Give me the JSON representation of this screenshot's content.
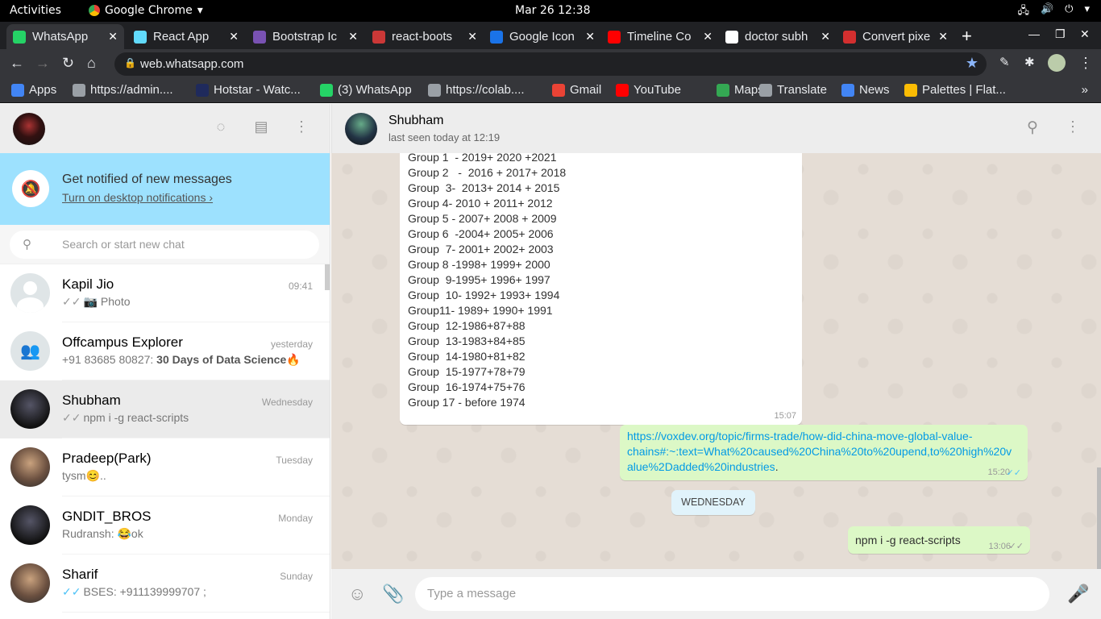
{
  "system": {
    "activities": "Activities",
    "app_name": "Google Chrome",
    "clock": "Mar 26  12:38"
  },
  "tabs": [
    {
      "title": "WhatsApp",
      "icon": "whatsapp-icon",
      "color": "#25d366",
      "active": true
    },
    {
      "title": "React App",
      "icon": "react-icon",
      "color": "#61dafb"
    },
    {
      "title": "Bootstrap Ic",
      "icon": "bootstrap-icon",
      "color": "#7952b3"
    },
    {
      "title": "react-boots",
      "icon": "npm-icon",
      "color": "#cb3837"
    },
    {
      "title": "Google Icon",
      "icon": "flag-icon",
      "color": "#1a73e8"
    },
    {
      "title": "Timeline Co",
      "icon": "youtube-icon",
      "color": "#ff0000"
    },
    {
      "title": "doctor subh",
      "icon": "google-icon",
      "color": "#ffffff"
    },
    {
      "title": "Convert pixe",
      "icon": "convert-icon",
      "color": "#d32f2f"
    }
  ],
  "address": {
    "url": "web.whatsapp.com"
  },
  "bookmarks": [
    {
      "label": "Apps",
      "icon": "apps-grid-icon",
      "color": "#4285f4"
    },
    {
      "label": "https://admin....",
      "icon": "globe-icon",
      "color": "#9aa0a6"
    },
    {
      "label": "Hotstar - Watc...",
      "icon": "hotstar-icon",
      "color": "#1f2a5c"
    },
    {
      "label": "(3) WhatsApp",
      "icon": "whatsapp-icon",
      "color": "#25d366"
    },
    {
      "label": "https://colab....",
      "icon": "globe-icon",
      "color": "#9aa0a6"
    },
    {
      "label": "Gmail",
      "icon": "gmail-icon",
      "color": "#ea4335"
    },
    {
      "label": "YouTube",
      "icon": "youtube-icon",
      "color": "#ff0000"
    },
    {
      "label": "Maps",
      "icon": "maps-icon",
      "color": "#34a853"
    },
    {
      "label": "Translate",
      "icon": "globe-icon",
      "color": "#9aa0a6"
    },
    {
      "label": "News",
      "icon": "news-icon",
      "color": "#4285f4"
    },
    {
      "label": "Palettes | Flat...",
      "icon": "palette-icon",
      "color": "#fbbc04"
    }
  ],
  "sidebar": {
    "notification": {
      "title": "Get notified of new messages",
      "link": "Turn on desktop notifications ›"
    },
    "search_placeholder": "Search or start new chat",
    "chats": [
      {
        "name": "Kapil Jio",
        "time": "09:41",
        "preview": "Photo",
        "ticks": "grey",
        "photo": true,
        "avatar": "default"
      },
      {
        "name": "Offcampus Explorer",
        "time": "yesterday",
        "sender": "+91 83685 80827: ",
        "preview": "30 Days of Data Science",
        "emoji": "🔥",
        "avatar": "group"
      },
      {
        "name": "Shubham",
        "time": "Wednesday",
        "preview": "npm i -g react-scripts",
        "ticks": "grey",
        "selected": true,
        "avatar": "dark"
      },
      {
        "name": "Pradeep(Park)",
        "time": "Tuesday",
        "preview": "tysm",
        "emoji": "😊",
        "suffix": "..",
        "avatar": "photo"
      },
      {
        "name": "GNDIT_BROS",
        "time": "Monday",
        "sender": "Rudransh: ",
        "emoji": "😂",
        "preview": "ok",
        "emoji_first": true,
        "avatar": "dark"
      },
      {
        "name": "Sharif",
        "time": "Sunday",
        "preview": "BSES: +911139999707 ;",
        "ticks": "blue",
        "avatar": "photo"
      }
    ]
  },
  "conversation": {
    "contact_name": "Shubham",
    "status": "last seen today at 12:19",
    "incoming": {
      "lines": [
        "Group 1  - 2019+ 2020 +2021",
        "Group 2   -  2016 + 2017+ 2018",
        "Group  3-  2013+ 2014 + 2015",
        "Group 4- 2010 + 2011+ 2012",
        "Group 5 - 2007+ 2008 + 2009",
        "Group 6  -2004+ 2005+ 2006",
        "Group  7- 2001+ 2002+ 2003",
        "Group 8 -1998+ 1999+ 2000",
        "Group  9-1995+ 1996+ 1997",
        "Group  10- 1992+ 1993+ 1994",
        "Group11- 1989+ 1990+ 1991",
        "Group  12-1986+87+88",
        "Group  13-1983+84+85",
        "Group  14-1980+81+82",
        "Group  15-1977+78+79",
        "Group  16-1974+75+76",
        "Group 17 - before 1974"
      ],
      "time": "15:07"
    },
    "link_message": {
      "text_l1": "https://voxdev.org/topic/firms-trade/how-did-china-move-global-value-",
      "text_l2": "chains#:~:text=What%20caused%20China%20to%20upend,to%20high%20v",
      "text_l3": "alue%2Dadded%20industries",
      "suffix": ".",
      "time": "15:20"
    },
    "day_separator": "WEDNESDAY",
    "last_message": {
      "text": "npm i -g react-scripts",
      "time": "13:06"
    },
    "input_placeholder": "Type a message"
  }
}
